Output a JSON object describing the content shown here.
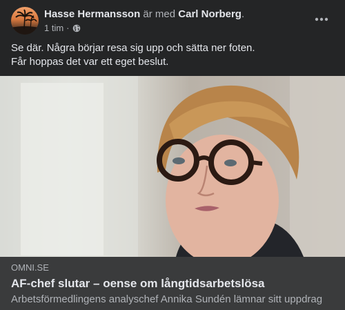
{
  "post": {
    "author": "Hasse Hermansson",
    "with_text": "är med",
    "tagged": "Carl Norberg",
    "tagged_suffix": ".",
    "time": "1 tim",
    "time_separator": "·",
    "privacy_icon": "globe-icon",
    "more_icon": "more-horizontal-icon",
    "text_lines": [
      "Se där. Några börjar resa sig upp och sätta ner foten.",
      "Får hoppas det var ett eget beslut."
    ]
  },
  "link_preview": {
    "domain": "OMNI.SE",
    "title": "AF-chef slutar – oense om långtidsarbetslösa",
    "description": "Arbetsförmedlingens analyschef Annika Sundén lämnar sitt uppdrag"
  },
  "colors": {
    "background": "#242526",
    "card": "#3a3b3c",
    "primary_text": "#e4e6eb",
    "secondary_text": "#b0b3b8"
  }
}
